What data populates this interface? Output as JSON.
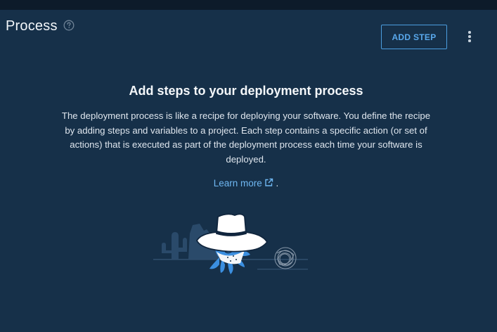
{
  "header": {
    "title": "Process",
    "add_step_label": "ADD STEP",
    "help_icon": "help-circle-icon",
    "more_icon": "more-vertical-icon"
  },
  "empty_state": {
    "title": "Add steps to your deployment process",
    "body": "The deployment process is like a recipe for deploying your software. You define the recipe by adding steps and variables to a project. Each step contains a specific action (or set of actions) that is executed as part of the deployment process each time your software is deployed.",
    "learn_more_label": "Learn more",
    "learn_more_suffix": ".",
    "external_icon": "external-link-icon",
    "illustration": "octopus-cowboy-illustration"
  },
  "colors": {
    "background": "#163049",
    "topbar": "#0d1b2a",
    "accent": "#59a8ec",
    "link": "#6fb7f2",
    "octopus": "#3b8fe0"
  }
}
